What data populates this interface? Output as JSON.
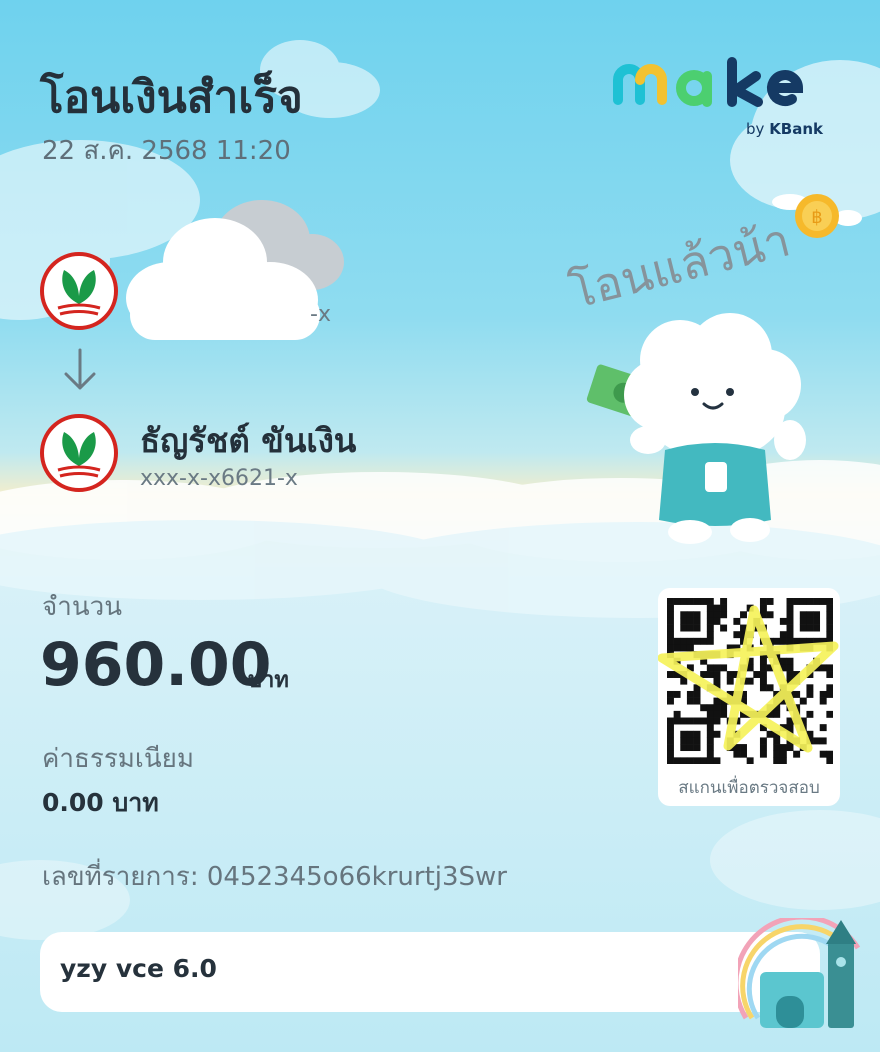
{
  "header": {
    "title": "โอนเงินสำเร็จ",
    "datetime": "22 ส.ค. 2568 11:20"
  },
  "brand": {
    "name": "make",
    "by_label": "by",
    "bank": "KBank",
    "colors": {
      "m": "#1ec1d4",
      "a": "#4ccf70",
      "ke": "#153a64"
    }
  },
  "decor": {
    "handwritten_caption": "โอนแล้วน้า",
    "coin_icon": "baht-coin-icon",
    "mascot": "cloud-mascot-holding-banknote"
  },
  "sender": {
    "bank_icon": "kbank-logo-icon",
    "account": "-x"
  },
  "transfer_arrow_icon": "arrow-down-icon",
  "receiver": {
    "bank_icon": "kbank-logo-icon",
    "name": "ธัญรัชต์ ขันเงิน",
    "account": "xxx-x-x6621-x"
  },
  "amount": {
    "label": "จำนวน",
    "value": "960.00",
    "unit": "บาท"
  },
  "fee": {
    "label": "ค่าธรรมเนียม",
    "value": "0.00 บาท"
  },
  "transaction": {
    "label": "เลขที่รายการ:",
    "id": "0452345o66krurtj3Swr"
  },
  "qr": {
    "caption": "สแกนเพื่อตรวจสอบ"
  },
  "memo": {
    "text": "yzy vce 6.0"
  },
  "colors": {
    "kbank_red": "#d4251f",
    "kbank_green": "#1a9a48",
    "text_dark": "#24303a",
    "text_muted": "#66757e"
  }
}
